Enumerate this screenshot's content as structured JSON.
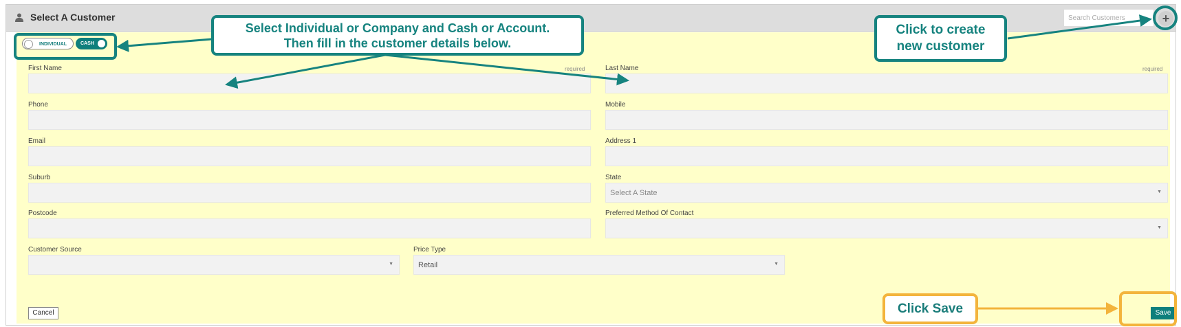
{
  "header": {
    "title": "Select A Customer",
    "search_placeholder": "Search Customers"
  },
  "toggles": {
    "individual": "INDIVIDUAL",
    "cash": "CASH"
  },
  "form": {
    "first_name": {
      "label": "First Name",
      "required": "required"
    },
    "last_name": {
      "label": "Last Name",
      "required": "required"
    },
    "phone": {
      "label": "Phone"
    },
    "mobile": {
      "label": "Mobile"
    },
    "email": {
      "label": "Email"
    },
    "address1": {
      "label": "Address 1"
    },
    "suburb": {
      "label": "Suburb"
    },
    "state": {
      "label": "State",
      "placeholder": "Select A State"
    },
    "postcode": {
      "label": "Postcode"
    },
    "preferred_contact": {
      "label": "Preferred Method Of Contact"
    },
    "customer_source": {
      "label": "Customer Source"
    },
    "price_type": {
      "label": "Price Type",
      "value": "Retail"
    }
  },
  "buttons": {
    "cancel": "Cancel",
    "save": "Save",
    "add": "+"
  },
  "callouts": {
    "select_line1": "Select Individual or Company and Cash or Account.",
    "select_line2": "Then fill in the customer details below.",
    "create_line1": "Click to create",
    "create_line2": "new customer",
    "save": "Click Save"
  },
  "colors": {
    "accent": "#0e7f7c",
    "form_background": "#ffffc9",
    "callout_teal": "#16837f",
    "callout_orange": "#f3b43c"
  }
}
